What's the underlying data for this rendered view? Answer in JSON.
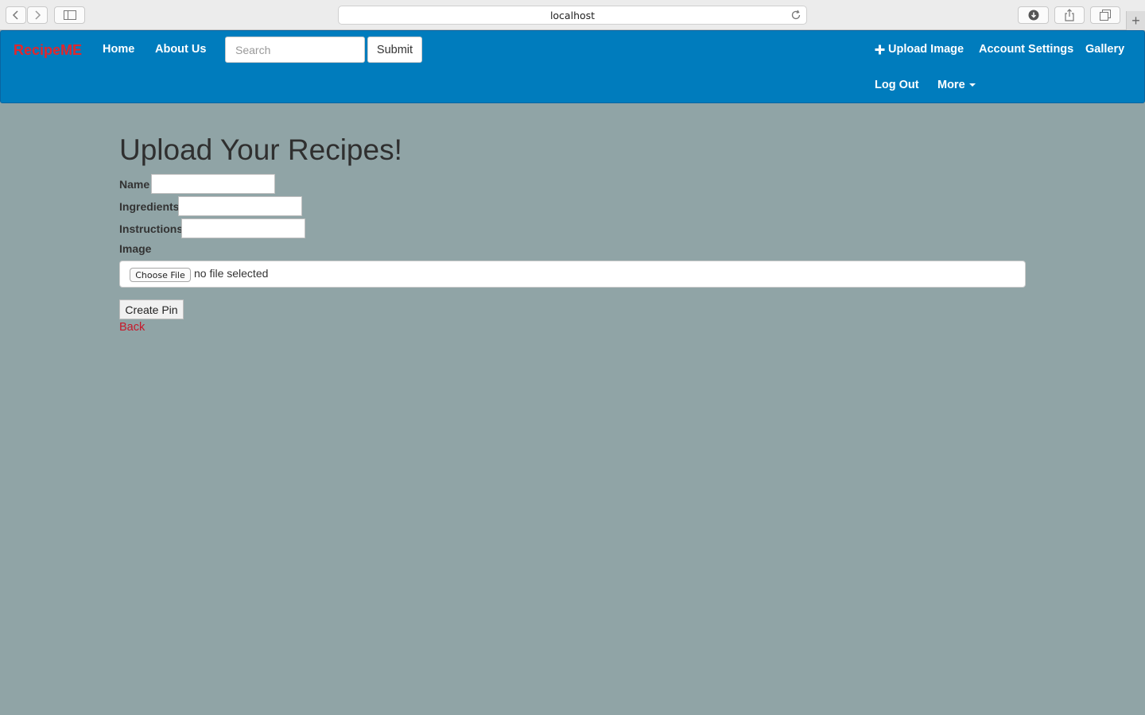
{
  "browser": {
    "url": "localhost"
  },
  "navbar": {
    "brand": "RecipeME",
    "links": {
      "home": "Home",
      "about": "About Us",
      "upload_image": "Upload Image",
      "account_settings": "Account Settings",
      "gallery": "Gallery",
      "log_out": "Log Out",
      "more": "More"
    },
    "search": {
      "placeholder": "Search",
      "value": ""
    },
    "submit_label": "Submit"
  },
  "main": {
    "title": "Upload Your Recipes!",
    "fields": {
      "name": {
        "label": "Name",
        "value": ""
      },
      "ingredients": {
        "label": "Ingredients",
        "value": ""
      },
      "instructions": {
        "label": "Instructions",
        "value": ""
      }
    },
    "image": {
      "label": "Image",
      "choose_label": "Choose File",
      "status": "no file selected"
    },
    "create_label": "Create Pin",
    "back_label": "Back"
  },
  "colors": {
    "navbar_bg": "#007cbd",
    "brand": "#e3262b",
    "page_bg": "#90a4a6",
    "back_link": "#c7182a"
  }
}
